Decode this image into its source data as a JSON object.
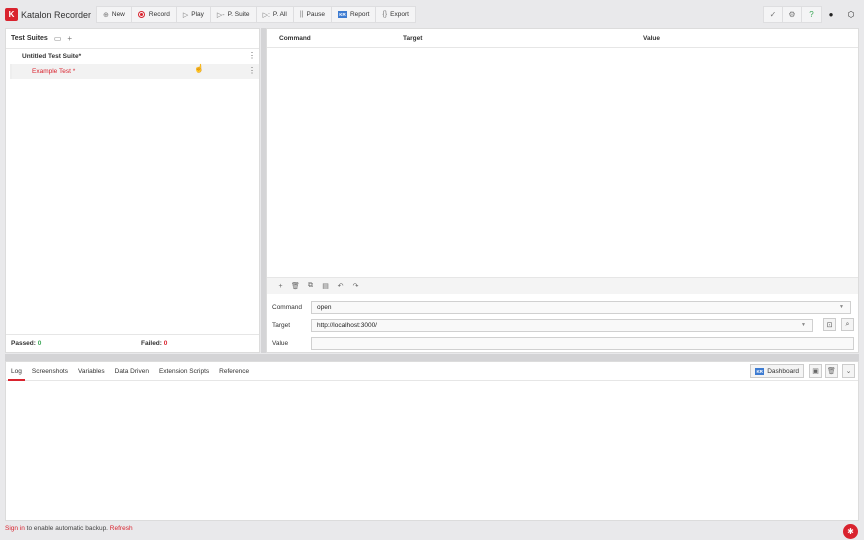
{
  "app": {
    "logo_mark": "K",
    "name": "Katalon Recorder"
  },
  "toolbar": {
    "buttons": [
      {
        "label": "New",
        "icon": "⊕"
      },
      {
        "label": "Record",
        "icon": "record"
      },
      {
        "label": "Play",
        "icon": "▷"
      },
      {
        "label": "P. Suite",
        "icon": "▷-"
      },
      {
        "label": "P. All",
        "icon": "▷:"
      },
      {
        "label": "Pause",
        "icon": "||"
      },
      {
        "label": "Report",
        "icon": "KR"
      },
      {
        "label": "Export",
        "icon": "{}"
      }
    ],
    "right_icons": [
      "check-circle-icon",
      "gear-icon",
      "help-icon",
      "github-icon",
      "package-icon"
    ]
  },
  "test_suites": {
    "title": "Test Suites",
    "suites": [
      {
        "name": "Untitled Test Suite*",
        "cases": [
          {
            "name": "Example Test *"
          }
        ]
      }
    ],
    "passed_label": "Passed:",
    "passed_count": "0",
    "failed_label": "Failed:",
    "failed_count": "0"
  },
  "commands_grid": {
    "columns": [
      "Command",
      "Target",
      "Value"
    ]
  },
  "editor": {
    "command_label": "Command",
    "command_value": "open",
    "target_label": "Target",
    "target_value": "http://localhost:3000/",
    "value_label": "Value",
    "value_value": ""
  },
  "log_panel": {
    "tabs": [
      "Log",
      "Screenshots",
      "Variables",
      "Data Driven",
      "Extension Scripts",
      "Reference"
    ],
    "active_tab": "Log",
    "dashboard_label": "Dashboard"
  },
  "status_bar": {
    "sign_in": "Sign in",
    "middle": " to enable automatic backup. ",
    "refresh": "Refresh"
  },
  "colors": {
    "accent": "#d9232e",
    "katalon_blue": "#3d7bd1"
  }
}
